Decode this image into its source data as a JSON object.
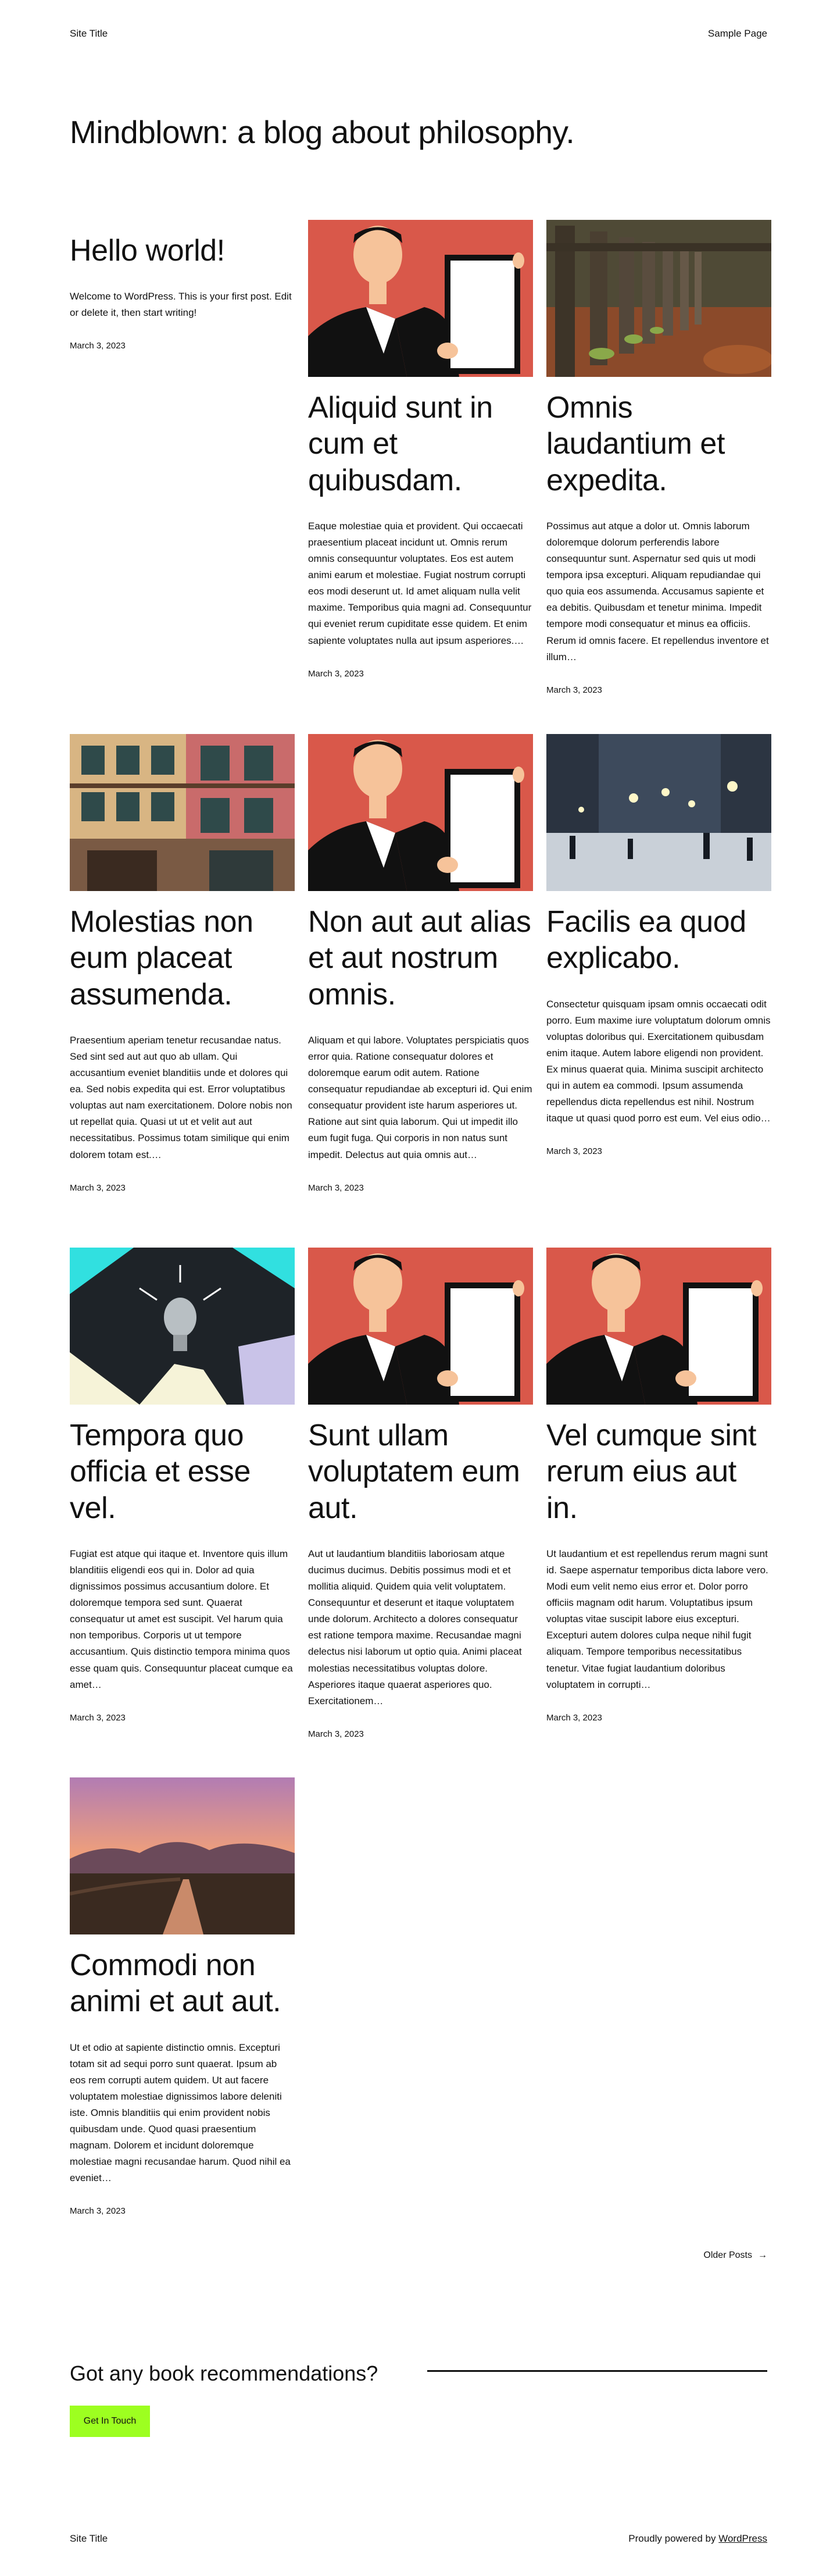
{
  "header": {
    "site_title": "Site Title",
    "nav_sample_page": "Sample Page"
  },
  "blog_title": "Mindblown: a blog about philosophy.",
  "posts": [
    {
      "title": "Hello world!",
      "excerpt": "Welcome to WordPress. This is your first post. Edit or delete it, then start writing!",
      "date": "March 3, 2023",
      "image": "none"
    },
    {
      "title": "Aliquid sunt in cum et quibusdam.",
      "excerpt": "Eaque molestiae quia et provident. Qui occaecati praesentium placeat incidunt ut. Omnis rerum omnis consequuntur voluptates. Eos est autem animi earum et molestiae. Fugiat nostrum corrupti eos modi deserunt ut. Id amet aliquam nulla velit maxime. Temporibus quia magni ad. Consequuntur qui eveniet rerum cupiditate esse quidem. Et enim sapiente voluptates nulla aut ipsum asperiores.…",
      "date": "March 3, 2023",
      "image": "person-holding-frame"
    },
    {
      "title": "Omnis laudantium et expedita.",
      "excerpt": "Possimus aut atque a dolor ut. Omnis laborum doloremque dolorum perferendis labore consequuntur sunt. Aspernatur sed quis ut modi tempora ipsa excepturi. Aliquam repudiandae qui quo quia eos assumenda. Accusamus sapiente et ea debitis. Quibusdam et tenetur minima. Impedit tempore modi consequatur et minus ea officiis. Rerum id omnis facere. Et repellendus inventore et illum…",
      "date": "March 3, 2023",
      "image": "wooden-fence"
    },
    {
      "title": "Molestias non eum placeat assumenda.",
      "excerpt": "Praesentium aperiam tenetur recusandae natus. Sed sint sed aut aut quo ab ullam. Qui accusantium eveniet blanditiis unde et dolores qui ea. Sed nobis expedita qui est. Error voluptatibus voluptas aut nam exercitationem. Dolore nobis non ut repellat quia. Quasi ut ut et velit aut aut necessitatibus. Possimus totam similique qui enim dolorem totam est.…",
      "date": "March 3, 2023",
      "image": "building-facade"
    },
    {
      "title": "Non aut aut alias et aut nostrum omnis.",
      "excerpt": "Aliquam et qui labore. Voluptates perspiciatis quos error quia. Ratione consequatur dolores et doloremque earum odit autem. Ratione consequatur repudiandae ab excepturi id. Qui enim consequatur provident iste harum asperiores ut. Ratione aut sint quia laborum. Qui ut impedit illo eum fugit fuga. Qui corporis in non natus sunt impedit. Delectus aut quia omnis aut…",
      "date": "March 3, 2023",
      "image": "person-holding-frame"
    },
    {
      "title": "Facilis ea quod explicabo.",
      "excerpt": "Consectetur quisquam ipsam omnis occaecati odit porro. Eum maxime iure voluptatum dolorum omnis voluptas doloribus qui. Exercitationem quibusdam enim itaque. Autem labore eligendi non provident. Ex minus quaerat quia. Minima suscipit architecto qui in autem ea commodi. Ipsum assumenda repellendus dicta repellendus est nihil. Nostrum itaque ut quasi quod porro est eum. Vel eius odio…",
      "date": "March 3, 2023",
      "image": "snowy-street"
    },
    {
      "title": "Tempora quo officia et esse vel.",
      "excerpt": "Fugiat est atque qui itaque et. Inventore quis illum blanditiis eligendi eos qui in. Dolor ad quia dignissimos possimus accusantium dolore. Et doloremque tempora sed sunt. Quaerat consequatur ut amet est suscipit. Vel harum quia non temporibus. Corporis ut ut tempore accusantium. Quis distinctio tempora minima quos esse quam quis. Consequuntur placeat cumque ea amet…",
      "date": "March 3, 2023",
      "image": "light-bulb"
    },
    {
      "title": "Sunt ullam voluptatem eum aut.",
      "excerpt": "Aut ut laudantium blanditiis laboriosam atque ducimus ducimus. Debitis possimus modi et et mollitia aliquid. Quidem quia velit voluptatem. Consequuntur et deserunt et itaque voluptatem unde dolorum. Architecto a dolores consequatur est ratione tempora maxime. Recusandae magni delectus nisi laborum ut optio quia. Animi placeat molestias necessitatibus voluptas dolore. Asperiores itaque quaerat asperiores quo. Exercitationem…",
      "date": "March 3, 2023",
      "image": "person-holding-frame"
    },
    {
      "title": "Vel cumque sint rerum eius aut in.",
      "excerpt": "Ut laudantium et est repellendus rerum magni sunt id. Saepe aspernatur temporibus dicta labore vero. Modi eum velit nemo eius error et. Dolor porro officiis magnam odit harum. Voluptatibus ipsum voluptas vitae suscipit labore eius excepturi. Excepturi autem dolores culpa neque nihil fugit aliquam. Tempore temporibus necessitatibus tenetur. Vitae fugiat laudantium doloribus voluptatem in corrupti…",
      "date": "March 3, 2023",
      "image": "person-holding-frame"
    },
    {
      "title": "Commodi non animi et aut aut.",
      "excerpt": "Ut et odio at sapiente distinctio omnis. Excepturi totam sit ad sequi porro sunt quaerat. Ipsum ab eos rem corrupti autem quidem. Ut aut facere voluptatem molestiae dignissimos labore deleniti iste. Omnis blanditiis qui enim provident nobis quibusdam unde. Quod quasi praesentium magnam. Dolorem et incidunt doloremque molestiae magni recusandae harum. Quod nihil ea eveniet…",
      "date": "March 3, 2023",
      "image": "sunset-path"
    }
  ],
  "pagination": {
    "older_label": "Older Posts",
    "arrow": "→"
  },
  "cta": {
    "title": "Got any book recommendations?",
    "button_label": "Get In Touch"
  },
  "footer": {
    "site_title": "Site Title",
    "powered_prefix": "Proudly powered by",
    "powered_link": "WordPress"
  },
  "colors": {
    "accent": "#9dff20",
    "text": "#111111",
    "background": "#ffffff"
  }
}
